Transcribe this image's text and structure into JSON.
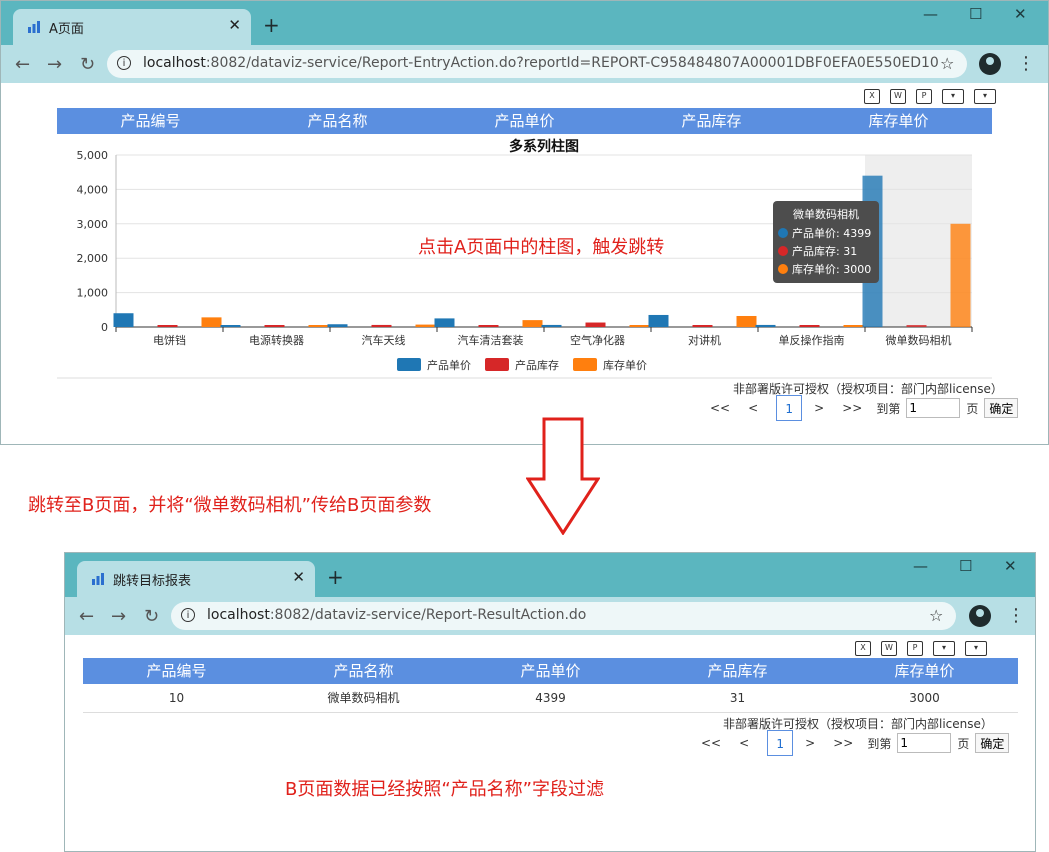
{
  "window_a": {
    "tab_title": "A页面",
    "url_host": "localhost",
    "url_rest": ":8082/dataviz-service/Report-EntryAction.do?reportId=REPORT-C958484807A00001DBF0EFA0E550ED10",
    "headers": [
      "产品编号",
      "产品名称",
      "产品单价",
      "产品库存",
      "库存单价"
    ],
    "license": "非部署版许可授权（授权项目：部门内部license）",
    "pager": {
      "first": "<<",
      "prev": "<",
      "current": "1",
      "next": ">",
      "last": ">>",
      "goto": "到第",
      "page_value": "1",
      "page_unit": "页",
      "confirm": "确定"
    }
  },
  "chart_data": {
    "type": "bar",
    "title": "多系列柱图",
    "categories": [
      "电饼铛",
      "电源转换器",
      "汽车天线",
      "汽车清洁套装",
      "空气净化器",
      "对讲机",
      "单反操作指南",
      "微单数码相机"
    ],
    "series": [
      {
        "name": "产品单价",
        "color": "#1f77b4",
        "values": [
          400,
          40,
          80,
          250,
          60,
          350,
          60,
          4399
        ]
      },
      {
        "name": "产品库存",
        "color": "#d62728",
        "values": [
          20,
          20,
          60,
          30,
          130,
          20,
          30,
          31
        ]
      },
      {
        "name": "库存单价",
        "color": "#ff7f0e",
        "values": [
          280,
          30,
          70,
          200,
          50,
          320,
          50,
          3000
        ]
      }
    ],
    "y_ticks": [
      "0",
      "1,000",
      "2,000",
      "3,000",
      "4,000",
      "5,000"
    ],
    "ylim": [
      0,
      5000
    ],
    "highlight_category": "微单数码相机",
    "tooltip": {
      "title": "微单数码相机",
      "lines": [
        "产品单价: 4399",
        "产品库存: 31",
        "库存单价: 3000"
      ]
    },
    "legend": "bottom"
  },
  "annotations": {
    "click_note": "点击A页面中的柱图，触发跳转",
    "jump_note": "跳转至B页面，并将“微单数码相机”传给B页面参数",
    "filter_note": "B页面数据已经按照“产品名称”字段过滤"
  },
  "window_b": {
    "tab_title": "跳转目标报表",
    "url_host": "localhost",
    "url_rest": ":8082/dataviz-service/Report-ResultAction.do",
    "headers": [
      "产品编号",
      "产品名称",
      "产品单价",
      "产品库存",
      "库存单价"
    ],
    "row": [
      "10",
      "微单数码相机",
      "4399",
      "31",
      "3000"
    ],
    "license": "非部署版许可授权（授权项目：部门内部license）",
    "pager": {
      "first": "<<",
      "prev": "<",
      "current": "1",
      "next": ">",
      "last": ">>",
      "goto": "到第",
      "page_value": "1",
      "page_unit": "页",
      "confirm": "确定"
    }
  }
}
